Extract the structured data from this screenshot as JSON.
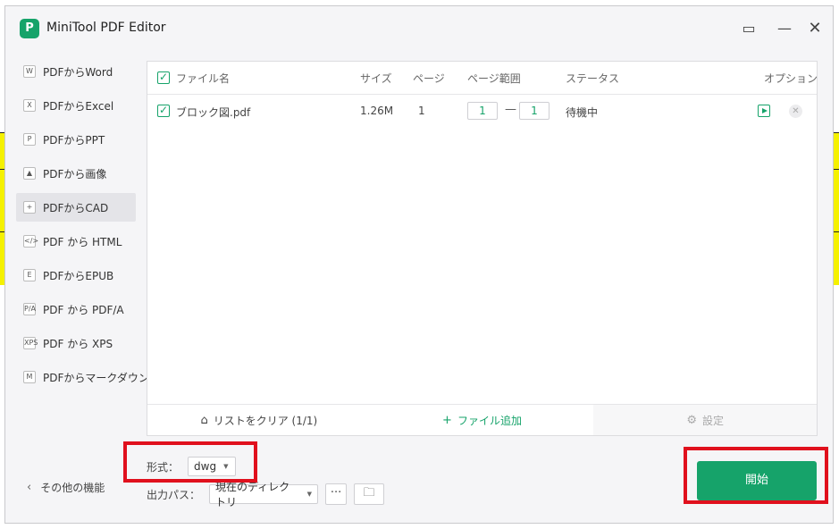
{
  "app": {
    "logo_text": "P",
    "title": "MiniTool PDF Editor"
  },
  "window_controls": {
    "help": "▭",
    "minimize": "—",
    "close": "✕"
  },
  "sidebar": {
    "items": [
      {
        "icon": "W",
        "label": "PDFからWord"
      },
      {
        "icon": "X",
        "label": "PDFからExcel"
      },
      {
        "icon": "P",
        "label": "PDFからPPT"
      },
      {
        "icon": "▲",
        "label": "PDFから画像"
      },
      {
        "icon": "+",
        "label": "PDFからCAD",
        "active": true
      },
      {
        "icon": "</>",
        "label": "PDF から HTML"
      },
      {
        "icon": "E",
        "label": "PDFからEPUB"
      },
      {
        "icon": "P/A",
        "label": "PDF から PDF/A"
      },
      {
        "icon": "XPS",
        "label": "PDF から XPS"
      },
      {
        "icon": "M",
        "label": "PDFからマークダウン"
      }
    ]
  },
  "table": {
    "headers": {
      "filename": "ファイル名",
      "size": "サイズ",
      "pages": "ページ",
      "page_range": "ページ範囲",
      "status": "ステータス",
      "options": "オプション"
    },
    "rows": [
      {
        "filename": "ブロック図.pdf",
        "size": "1.26M",
        "pages": "1",
        "range_from": "1",
        "range_to": "1",
        "status": "待機中"
      }
    ]
  },
  "footer": {
    "clear_list": "リストをクリア (1/1)",
    "add_file": "ファイル追加",
    "settings": "設定"
  },
  "format": {
    "label": "形式：",
    "value": "dwg"
  },
  "output": {
    "label": "出力パス：",
    "value": "現在のディレクトリ",
    "more": "···"
  },
  "other_features": "その他の機能",
  "start_button": "開始",
  "colors": {
    "accent": "#16a36a",
    "highlight": "#e0101d"
  }
}
